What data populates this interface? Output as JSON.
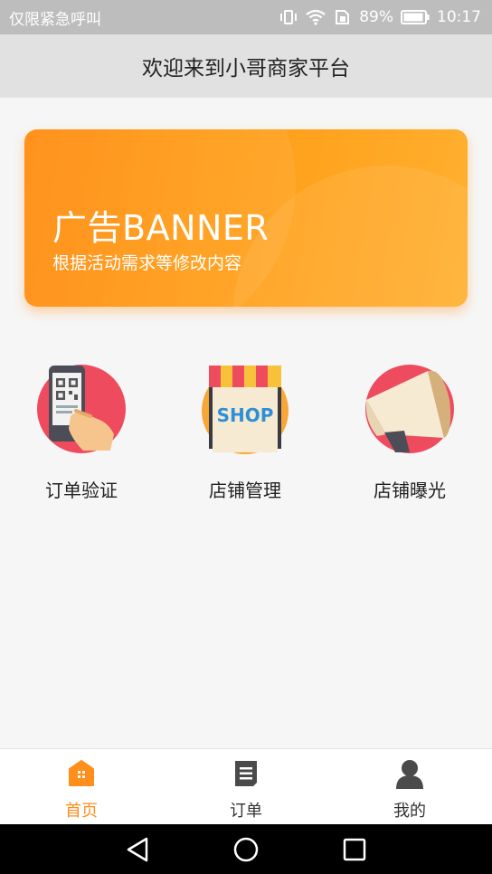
{
  "status": {
    "carrier": "仅限紧急呼叫",
    "battery": "89%",
    "time": "10:17"
  },
  "header": {
    "title": "欢迎来到小哥商家平台"
  },
  "banner": {
    "title": "广告BANNER",
    "subtitle": "根据活动需求等修改内容"
  },
  "features": [
    {
      "label": "订单验证",
      "icon": "qr-scan-icon"
    },
    {
      "label": "店铺管理",
      "icon": "shop-icon"
    },
    {
      "label": "店铺曝光",
      "icon": "megaphone-icon"
    }
  ],
  "tabs": [
    {
      "label": "首页",
      "icon": "home-icon",
      "active": true
    },
    {
      "label": "订单",
      "icon": "order-icon",
      "active": false
    },
    {
      "label": "我的",
      "icon": "profile-icon",
      "active": false
    }
  ],
  "colors": {
    "accent": "#ff8e1a",
    "banner_start": "#ff8a0c",
    "banner_end": "#ffb030"
  }
}
